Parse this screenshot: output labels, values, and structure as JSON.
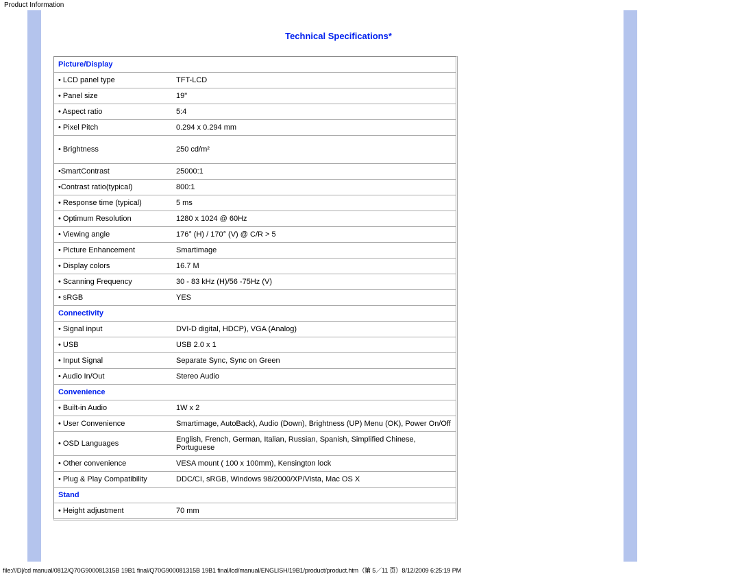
{
  "page_header": "Product Information",
  "title": "Technical Specifications*",
  "sections": [
    {
      "name": "Picture/Display",
      "rows": [
        {
          "label": "• LCD panel type",
          "value": "TFT-LCD"
        },
        {
          "label": "• Panel size",
          "value": "19\""
        },
        {
          "label": "• Aspect ratio",
          "value": "5:4"
        },
        {
          "label": "• Pixel Pitch",
          "value": "0.294 x 0.294 mm"
        },
        {
          "label": "• Brightness",
          "value": "250 cd/m²",
          "tall": true
        },
        {
          "label": "•SmartContrast",
          "value": "25000:1"
        },
        {
          "label": "•Contrast ratio(typical)",
          "value": "800:1"
        },
        {
          "label": "• Response time (typical)",
          "value": "5 ms"
        },
        {
          "label": "• Optimum Resolution",
          "value": "1280 x 1024 @ 60Hz"
        },
        {
          "label": "• Viewing angle",
          "value": "176° (H) / 170° (V) @ C/R > 5"
        },
        {
          "label": "• Picture Enhancement",
          "value": "Smartimage"
        },
        {
          "label": "• Display colors",
          "value": "16.7 M"
        },
        {
          "label": "• Scanning Frequency",
          "value": "30 - 83 kHz (H)/56 -75Hz (V)"
        },
        {
          "label": "• sRGB",
          "value": "  YES"
        }
      ]
    },
    {
      "name": "Connectivity",
      "rows": [
        {
          "label": "• Signal input",
          "value": "DVI-D digital, HDCP), VGA (Analog)"
        },
        {
          "label": "• USB",
          "value": "USB 2.0 x 1"
        },
        {
          "label": "• Input Signal",
          "value": "Separate Sync, Sync on Green"
        },
        {
          "label": "• Audio In/Out",
          "value": "Stereo Audio"
        }
      ]
    },
    {
      "name": "Convenience",
      "rows": [
        {
          "label": "• Built-in Audio",
          "value": "1W x 2"
        },
        {
          "label": "• User Convenience",
          "value": "Smartimage, AutoBack), Audio (Down), Brightness (UP) Menu (OK), Power On/Off"
        },
        {
          "label": "• OSD Languages",
          "value": "English, French, German, Italian, Russian, Spanish, Simplified Chinese, Portuguese"
        },
        {
          "label": "• Other convenience",
          "value": "VESA mount ( 100 x 100mm), Kensington lock"
        },
        {
          "label": "• Plug & Play Compatibility",
          "value": "DDC/CI, sRGB, Windows 98/2000/XP/Vista, Mac OS X"
        }
      ]
    },
    {
      "name": "Stand",
      "rows": [
        {
          "label": "• Height adjustment",
          "value": "70 mm"
        }
      ]
    }
  ],
  "footer": "file:///D|/cd manual/0812/Q70G900081315B 19B1 final/Q70G900081315B 19B1 final/lcd/manual/ENGLISH/19B1/product/product.htm（第 5／11 页）8/12/2009 6:25:19 PM"
}
